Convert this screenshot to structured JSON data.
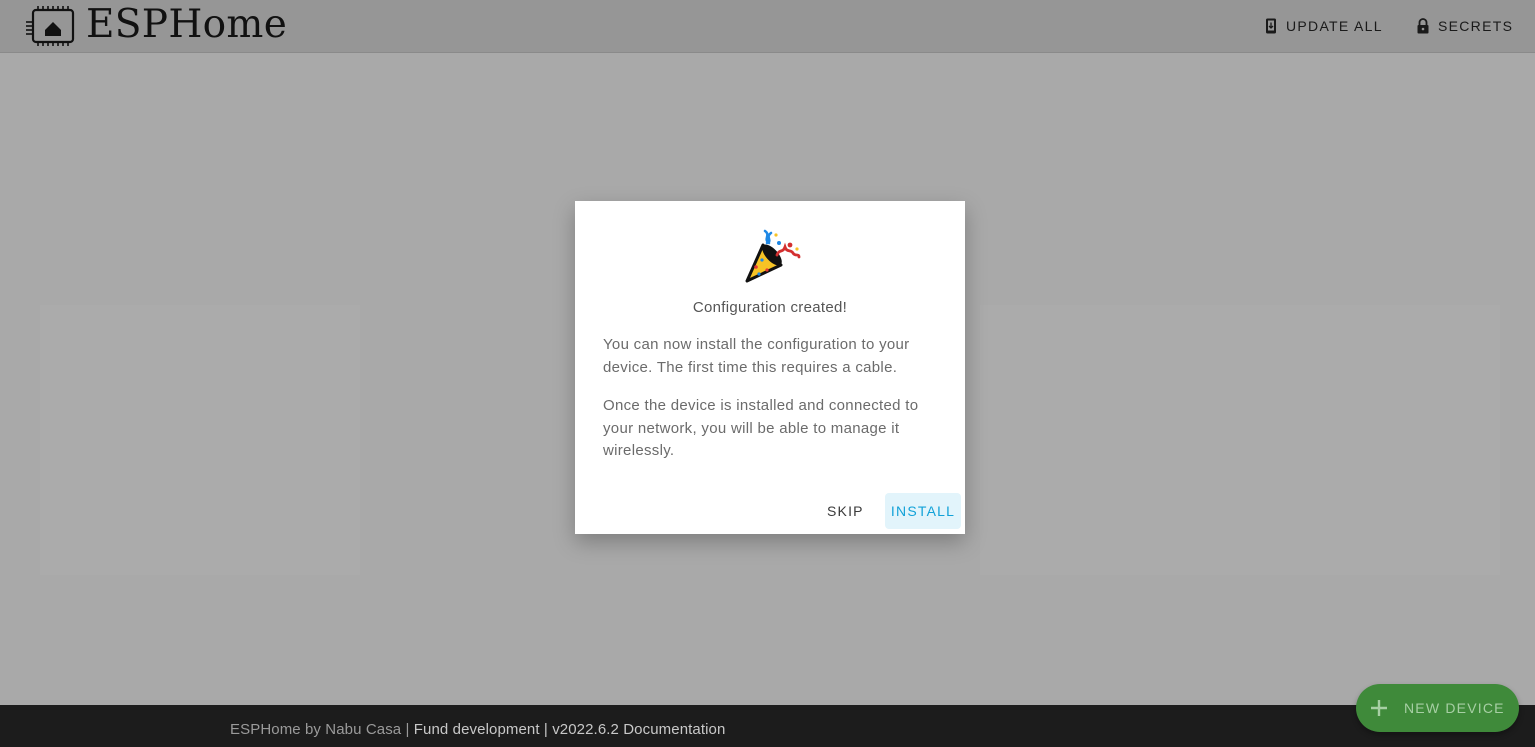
{
  "header": {
    "brand": "ESPHome",
    "update_all_label": "UPDATE ALL",
    "secrets_label": "SECRETS"
  },
  "dialog": {
    "title": "Configuration created!",
    "paragraph1": "You can now install the configuration to your device. The first time this requires a cable.",
    "paragraph2": "Once the device is installed and connected to your network, you will be able to manage it wirelessly.",
    "skip_label": "SKIP",
    "install_label": "INSTALL"
  },
  "footer": {
    "prefix": "ESPHome by Nabu Casa | ",
    "fund_link": "Fund development",
    "separator": " | ",
    "version_docs": "v2022.6.2 Documentation"
  },
  "fab": {
    "label": "NEW DEVICE"
  },
  "colors": {
    "accent": "#12a2d8",
    "fab_green": "#3f8a3a",
    "footer_bg": "#1c1c1c"
  }
}
